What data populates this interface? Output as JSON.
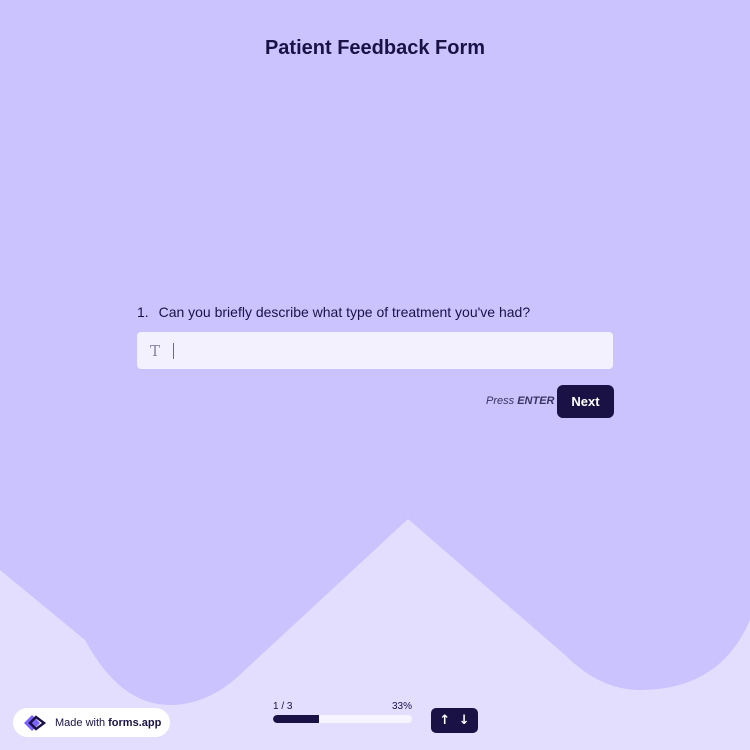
{
  "form": {
    "title": "Patient Feedback Form"
  },
  "question": {
    "number": "1.",
    "text": "Can you briefly describe what type of treatment you've had?",
    "answer_value": "",
    "answer_placeholder": "",
    "input_icon": "text-type-icon",
    "input_icon_glyph": "T"
  },
  "actions": {
    "press_hint_prefix": "Press",
    "press_hint_key": "ENTER",
    "next_label": "Next"
  },
  "footer": {
    "made_with_prefix": "Made with",
    "made_with_brand": "forms.app",
    "progress_text": "1 / 3",
    "progress_percent_text": "33%",
    "progress_fraction": 0.33,
    "nav_up": "↑",
    "nav_down": "↓"
  },
  "colors": {
    "background_top": "#cbc3fe",
    "background_bottom": "#e3defd",
    "accent": "#1a1245",
    "input_bg": "#f3f1fd"
  }
}
